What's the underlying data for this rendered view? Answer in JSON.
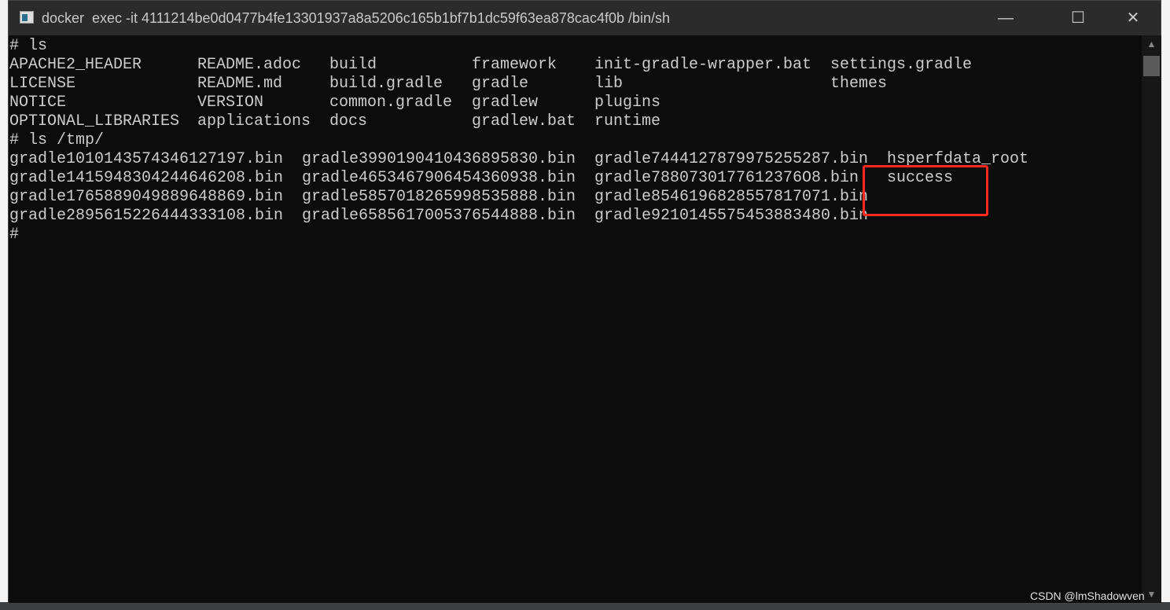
{
  "window": {
    "title": "docker  exec -it 4111214be0d0477b4fe13301937a8a5206c165b1bf7b1dc59f63ea878cac4f0b /bin/sh",
    "controls": {
      "minimize": "—",
      "maximize": "☐",
      "close": "✕"
    }
  },
  "terminal": {
    "prompt1": "# ls",
    "ls_rows": [
      [
        "APACHE2_HEADER",
        "README.adoc",
        "build",
        "framework",
        "init-gradle-wrapper.bat",
        "settings.gradle"
      ],
      [
        "LICENSE",
        "README.md",
        "build.gradle",
        "gradle",
        "lib",
        "themes"
      ],
      [
        "NOTICE",
        "VERSION",
        "common.gradle",
        "gradlew",
        "plugins",
        ""
      ],
      [
        "OPTIONAL_LIBRARIES",
        "applications",
        "docs",
        "gradlew.bat",
        "runtime",
        ""
      ]
    ],
    "prompt2": "# ls /tmp/",
    "tmp_rows": [
      [
        "gradle1010143574346127197.bin",
        "gradle3990190410436895830.bin",
        "gradle7444127879975255287.bin",
        "hsperfdata_root"
      ],
      [
        "gradle1415948304244646208.bin",
        "gradle4653467906454360938.bin",
        "gradle7880730177612376O8.bin",
        "success"
      ],
      [
        "gradle1765889049889648869.bin",
        "gradle5857018265998535888.bin",
        "gradle8546196828557817071.bin",
        ""
      ],
      [
        "gradle2895615226444333108.bin",
        "gradle6585617005376544888.bin",
        "gradle9210145575453883480.bin",
        ""
      ]
    ],
    "prompt3": "#"
  },
  "highlight_color": "#ff2a1f",
  "watermark": "CSDN @lmShadowven"
}
